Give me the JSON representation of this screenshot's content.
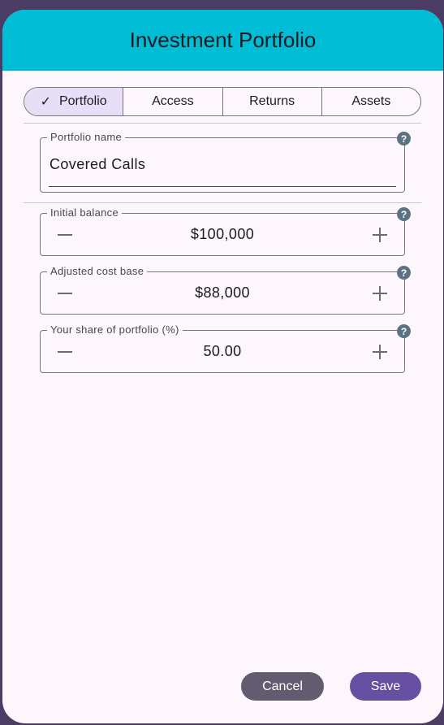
{
  "dialog": {
    "title": "Investment Portfolio"
  },
  "tabs": [
    {
      "label": "Portfolio",
      "selected": true
    },
    {
      "label": "Access",
      "selected": false
    },
    {
      "label": "Returns",
      "selected": false
    },
    {
      "label": "Assets",
      "selected": false
    }
  ],
  "portfolio_name": {
    "label": "Portfolio name",
    "value": "Covered Calls"
  },
  "initial_balance": {
    "label": "Initial balance",
    "value": "$100,000"
  },
  "adjusted_cost_base": {
    "label": "Adjusted cost base",
    "value": "$88,000"
  },
  "share_of_portfolio": {
    "label": "Your share of portfolio (%)",
    "value": "50.00"
  },
  "help_glyph": "?",
  "check_glyph": "✓",
  "actions": {
    "cancel_label": "Cancel",
    "save_label": "Save"
  },
  "colors": {
    "header": "#00bcd4",
    "dialog_bg": "#fdf6fd",
    "selected_tab": "#e8def8",
    "save_button": "#6750a4",
    "cancel_button": "#635b70",
    "help_icon": "#5a7282"
  }
}
